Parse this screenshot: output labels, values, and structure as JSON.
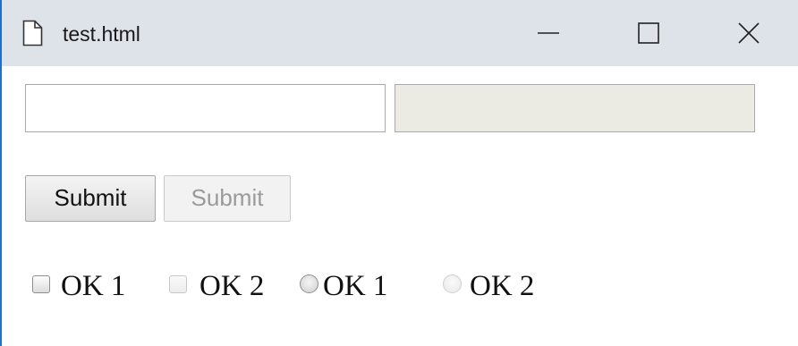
{
  "window": {
    "title": "test.html",
    "controls": {
      "minimize_icon": "minimize-icon",
      "maximize_icon": "maximize-icon",
      "close_icon": "close-icon"
    }
  },
  "form": {
    "text_input_1": {
      "value": "",
      "placeholder": ""
    },
    "text_input_2": {
      "value": "",
      "placeholder": "",
      "disabled": true
    },
    "submit_button_1": "Submit",
    "submit_button_2": {
      "label": "Submit",
      "disabled": true
    },
    "checkbox_1": {
      "label": "OK 1",
      "checked": false,
      "disabled": false
    },
    "checkbox_2": {
      "label": "OK 2",
      "checked": false,
      "disabled": true
    },
    "radio_1": {
      "label": "OK 1",
      "checked": false,
      "disabled": false
    },
    "radio_2": {
      "label": "OK 2",
      "checked": false,
      "disabled": true
    }
  },
  "colors": {
    "titlebar_bg": "#dee3ea",
    "disabled_field_bg": "#ebebe4",
    "window_border": "#1f6fd1"
  }
}
